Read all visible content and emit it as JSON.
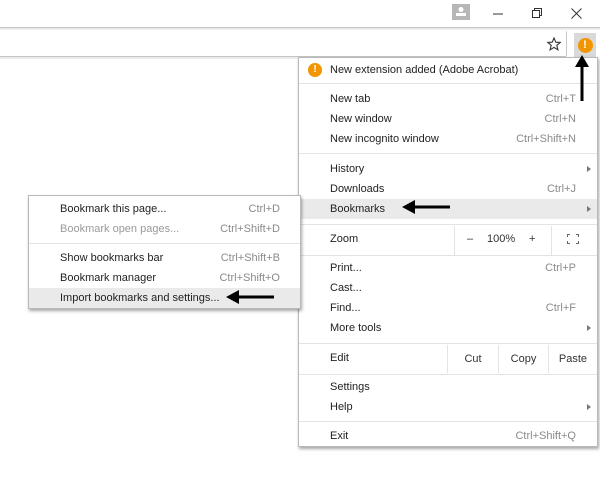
{
  "titlebar": {
    "profile_icon": "person-icon",
    "minimize_icon": "minimize-icon",
    "restore_icon": "restore-icon",
    "close_icon": "close-icon"
  },
  "toolbar": {
    "omnibox_value": "",
    "star_icon": "star-icon",
    "menu_badge": "!",
    "menu_badge_color": "#f29500"
  },
  "menu": {
    "extension_notice": {
      "icon_text": "!",
      "label": "New extension added (Adobe Acrobat)"
    },
    "items_group1": [
      {
        "label": "New tab",
        "shortcut": "Ctrl+T"
      },
      {
        "label": "New window",
        "shortcut": "Ctrl+N"
      },
      {
        "label": "New incognito window",
        "shortcut": "Ctrl+Shift+N"
      }
    ],
    "items_group2": [
      {
        "label": "History",
        "shortcut": ""
      },
      {
        "label": "Downloads",
        "shortcut": "Ctrl+J"
      },
      {
        "label": "Bookmarks",
        "shortcut": ""
      }
    ],
    "zoom": {
      "label": "Zoom",
      "minus": "–",
      "value": "100%",
      "plus": "+"
    },
    "items_group3": [
      {
        "label": "Print...",
        "shortcut": "Ctrl+P"
      },
      {
        "label": "Cast...",
        "shortcut": ""
      },
      {
        "label": "Find...",
        "shortcut": "Ctrl+F"
      },
      {
        "label": "More tools",
        "shortcut": ""
      }
    ],
    "edit": {
      "label": "Edit",
      "cut": "Cut",
      "copy": "Copy",
      "paste": "Paste"
    },
    "items_group4": [
      {
        "label": "Settings",
        "shortcut": ""
      },
      {
        "label": "Help",
        "shortcut": ""
      }
    ],
    "exit": {
      "label": "Exit",
      "shortcut": "Ctrl+Shift+Q"
    }
  },
  "bookmarks_submenu": {
    "items": [
      {
        "label": "Bookmark this page...",
        "shortcut": "Ctrl+D",
        "enabled": true
      },
      {
        "label": "Bookmark open pages...",
        "shortcut": "Ctrl+Shift+D",
        "enabled": false
      },
      {
        "label": "Show bookmarks bar",
        "shortcut": "Ctrl+Shift+B",
        "enabled": true
      },
      {
        "label": "Bookmark manager",
        "shortcut": "Ctrl+Shift+O",
        "enabled": true
      },
      {
        "label": "Import bookmarks and settings...",
        "shortcut": "",
        "enabled": true
      }
    ]
  },
  "annotations": {
    "arrow_color": "#000000"
  }
}
